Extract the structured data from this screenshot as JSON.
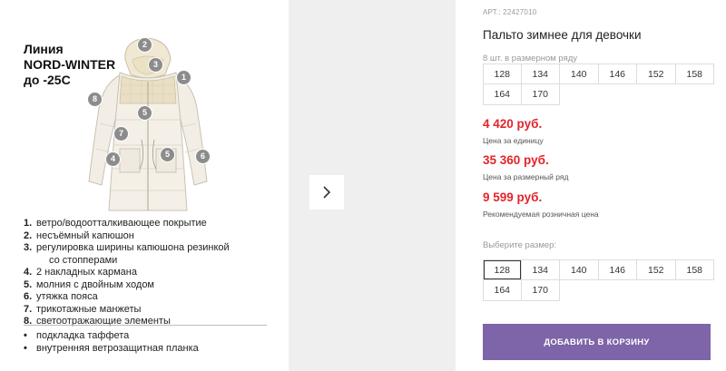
{
  "infographic": {
    "line_title_1": "Линия",
    "line_title_2": "NORD-WINTER",
    "line_title_3": "до -25С",
    "markers": [
      "1",
      "2",
      "3",
      "4",
      "5",
      "5",
      "6",
      "7",
      "8"
    ],
    "features": [
      {
        "num": "1.",
        "text": "ветро/водоотталкивающее покрытие"
      },
      {
        "num": "2.",
        "text": "несъёмный капюшон"
      },
      {
        "num": "3.",
        "text": "регулировка ширины капюшона  резинкой"
      },
      {
        "num": "",
        "text": "со стопперами"
      },
      {
        "num": "4.",
        "text": "2 накладных кармана"
      },
      {
        "num": "5.",
        "text": "молния с двойным ходом"
      },
      {
        "num": "6.",
        "text": "утяжка пояса"
      },
      {
        "num": "7.",
        "text": "трикотажные манжеты"
      },
      {
        "num": "8.",
        "text": "светоотражающие элементы"
      }
    ],
    "extras": [
      {
        "bullet": "•",
        "text": "подкладка таффета"
      },
      {
        "bullet": "•",
        "text": "внутренняя ветрозащитная планка"
      }
    ]
  },
  "gallery": {
    "next_icon": "chevron-right-icon"
  },
  "product": {
    "article": "АРТ.: 22427010",
    "title": "Пальто зимнее для девочки",
    "range_label": "8 шт. в размерном ряду",
    "range_sizes": [
      "128",
      "134",
      "140",
      "146",
      "152",
      "158",
      "164",
      "170"
    ],
    "price_unit": "4 420 руб.",
    "price_unit_note": "Цена за единицу",
    "price_range": "35 360 руб.",
    "price_range_note": "Цена за размерный ряд",
    "price_retail": "9 599 руб.",
    "price_retail_note": "Рекомендуемая розничная цена",
    "size_label": "Выберите размер:",
    "select_sizes": [
      "128",
      "134",
      "140",
      "146",
      "152",
      "158",
      "164",
      "170"
    ],
    "selected_size": "128",
    "add_to_cart": "ДОБАВИТЬ В КОРЗИНУ"
  },
  "colors": {
    "price": "#e3242b",
    "button": "#7e64a8",
    "gallery_bg": "#efefef",
    "marker": "#8c8c8c"
  }
}
